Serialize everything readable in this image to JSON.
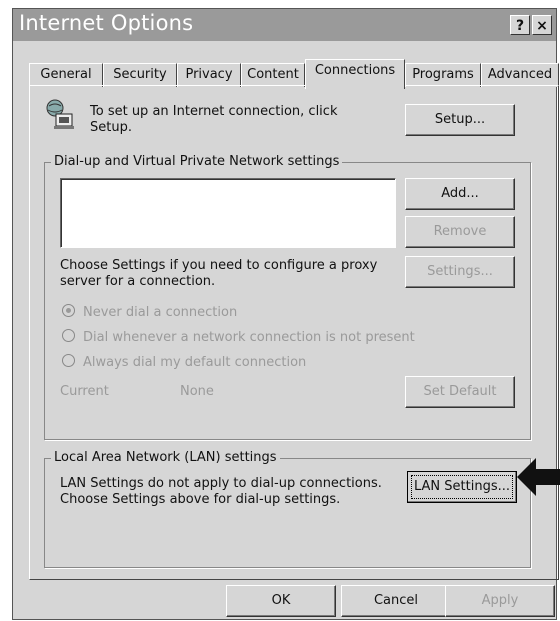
{
  "window": {
    "title": "Internet Options",
    "help_label": "?",
    "close_label": "×"
  },
  "tabs": [
    {
      "label": "General"
    },
    {
      "label": "Security"
    },
    {
      "label": "Privacy"
    },
    {
      "label": "Content"
    },
    {
      "label": "Connections",
      "active": true
    },
    {
      "label": "Programs"
    },
    {
      "label": "Advanced"
    }
  ],
  "setup": {
    "text": "To set up an Internet connection, click Setup.",
    "button": "Setup..."
  },
  "dialup": {
    "legend": "Dial-up and Virtual Private Network settings",
    "add_button": "Add...",
    "remove_button": "Remove",
    "settings_text": "Choose Settings if you need to configure a proxy server for a connection.",
    "settings_button": "Settings...",
    "radios": [
      {
        "label": "Never dial a connection",
        "selected": true
      },
      {
        "label": "Dial whenever a network connection is not present",
        "selected": false
      },
      {
        "label": "Always dial my default connection",
        "selected": false
      }
    ],
    "current_label": "Current",
    "current_value": "None",
    "set_default_button": "Set Default"
  },
  "lan": {
    "legend": "Local Area Network (LAN) settings",
    "text": "LAN Settings do not apply to dial-up connections. Choose Settings above for dial-up settings.",
    "button": "LAN Settings..."
  },
  "footer": {
    "ok": "OK",
    "cancel": "Cancel",
    "apply": "Apply"
  },
  "colors": {
    "titlebar": "#9a9a9a",
    "window": "#d6d6d6",
    "disabled_text": "#9a9a9a"
  }
}
